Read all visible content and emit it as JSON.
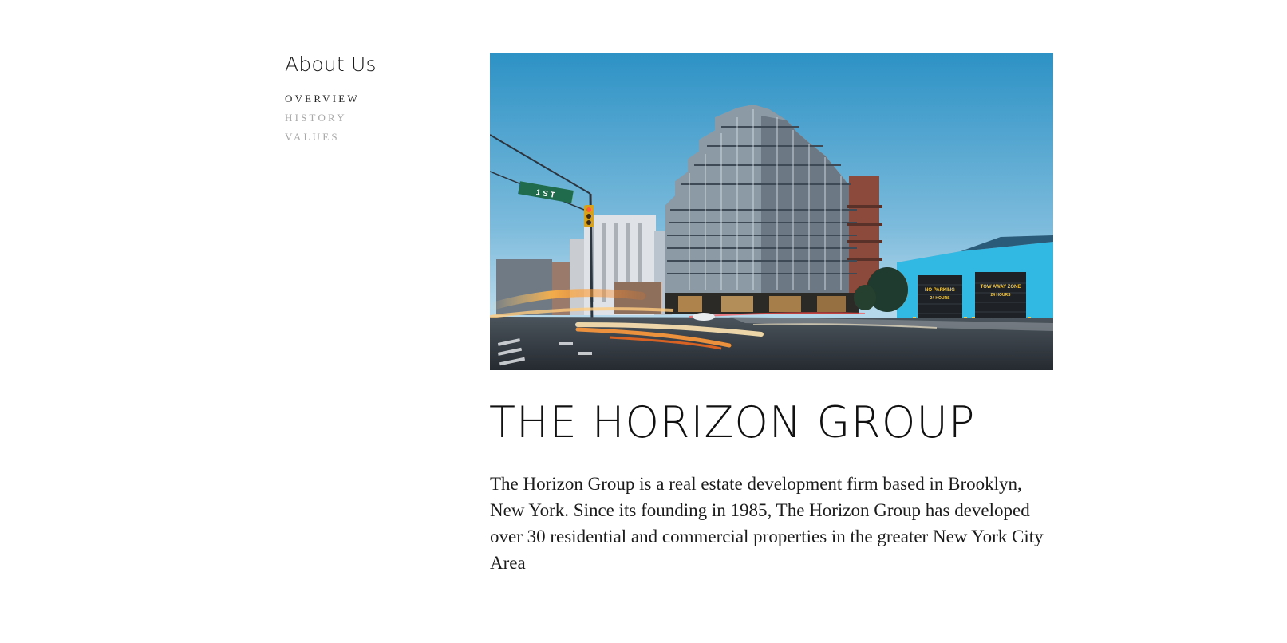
{
  "sidebar": {
    "title": "About Us",
    "items": [
      {
        "label": "OVERVIEW",
        "active": true
      },
      {
        "label": "HISTORY",
        "active": false
      },
      {
        "label": "VALUES",
        "active": false
      }
    ]
  },
  "main": {
    "headline": "THE HORIZON GROUP",
    "intro": "The Horizon Group is a real estate development firm based in Brooklyn, New York. Since its founding in 1985, The Horizon Group has developed over 30 residential and commercial properties in the greater New York City Area",
    "hero": {
      "street_sign": "1 S T",
      "garage_sign_left": "NO PARKING",
      "garage_sign_left_sub": "24 HOURS",
      "garage_sign_right": "TOW AWAY ZONE",
      "garage_sign_right_sub": "24 HOURS"
    }
  }
}
